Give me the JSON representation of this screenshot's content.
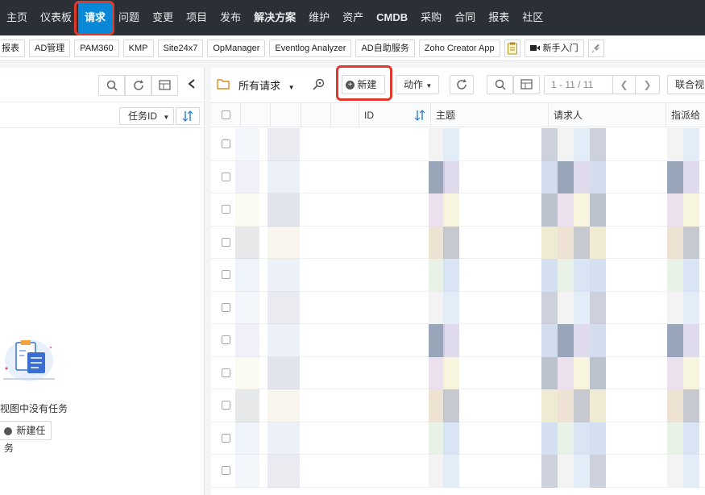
{
  "topnav": {
    "items": [
      "主页",
      "仪表板",
      "请求",
      "问题",
      "变更",
      "项目",
      "发布",
      "解决方案",
      "维护",
      "资产",
      "CMDB",
      "采购",
      "合同",
      "报表",
      "社区"
    ],
    "active_index": 2
  },
  "toolbar": {
    "chips": [
      "报表",
      "AD管理",
      "PAM360",
      "KMP",
      "Site24x7",
      "OpManager",
      "Eventlog Analyzer",
      "AD自助服务",
      "Zoho Creator App"
    ],
    "newbie_label": "新手入门"
  },
  "left_panel": {
    "sort_label": "任务ID",
    "empty_text": "视图中没有任务",
    "new_task_label": "新建任务"
  },
  "right_panel": {
    "view_title": "所有请求",
    "new_label": "新建",
    "action_label": "动作",
    "pagination": "1 - 11 / 11",
    "merge_view_label": "联合视图",
    "columns": [
      "ID",
      "主题",
      "请求人",
      "指派给"
    ]
  },
  "colors": {
    "nav_bg": "#2b2f36",
    "accent": "#0a88d8",
    "highlight": "#e0392b"
  }
}
